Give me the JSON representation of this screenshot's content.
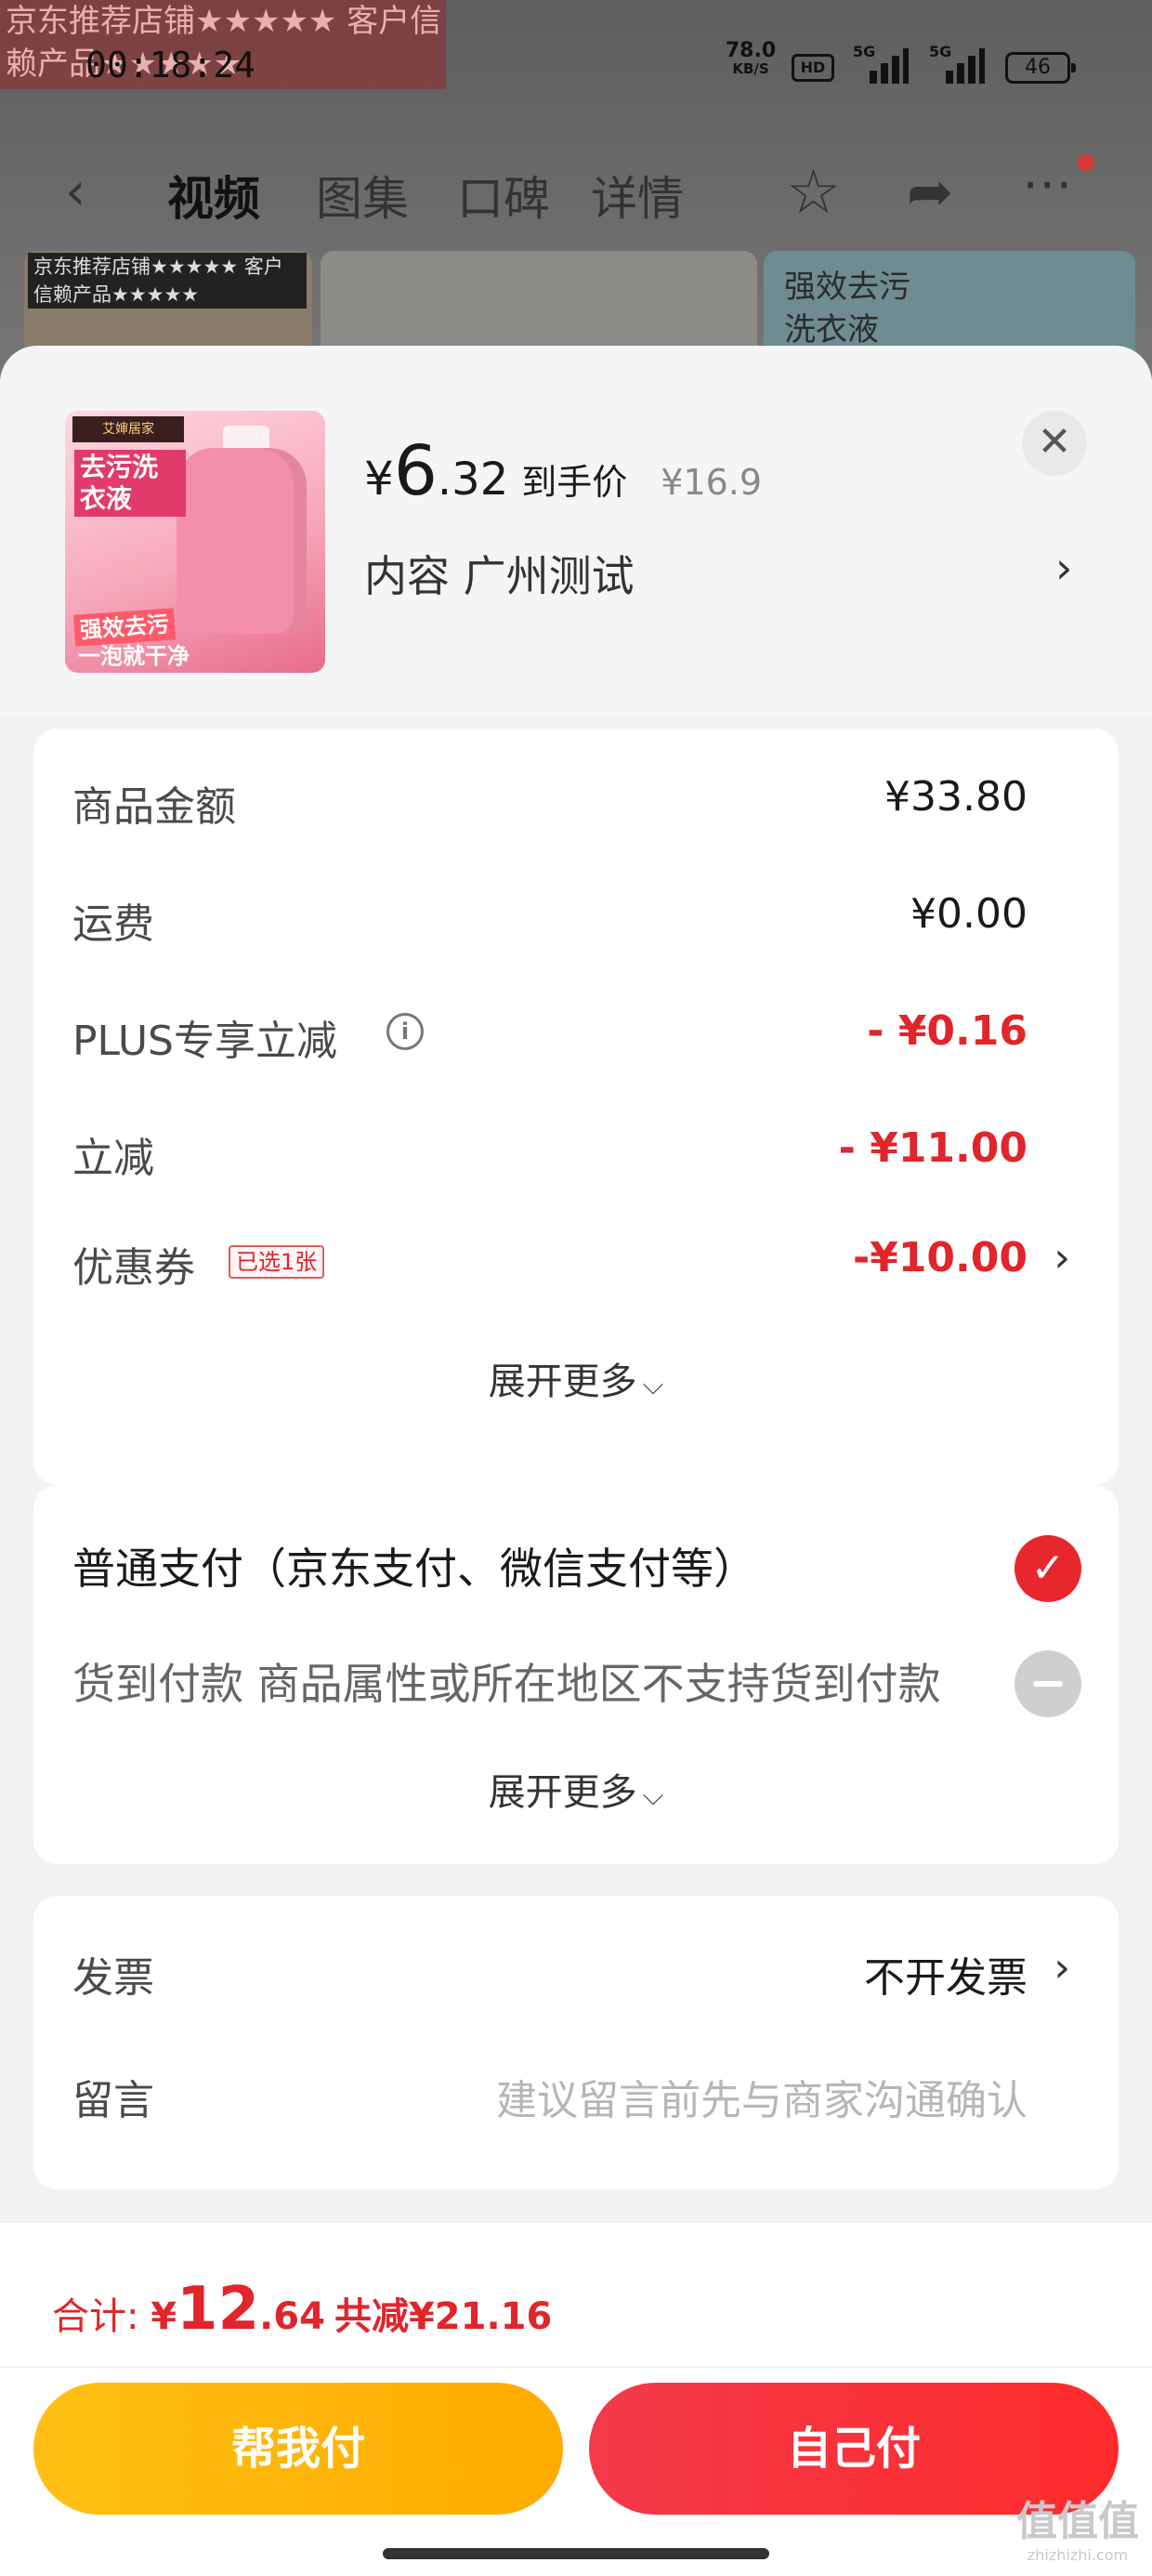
{
  "background": {
    "stamp": "京东推荐店铺★★★★★ 客户信赖产品★★★★★",
    "status_bar": {
      "time": "00:18:24",
      "net_speed": "78.0",
      "net_unit": "KB/S",
      "hd": "HD",
      "sig1": "5G",
      "sig2": "5G",
      "battery": "46"
    },
    "nav": {
      "tabs": [
        "视频",
        "图集",
        "口碑",
        "详情"
      ]
    },
    "thumb_tag": "京东推荐店铺★★★★★ 客户信赖产品★★★★★",
    "thumb_caption": "强效去污\n洗衣液"
  },
  "product": {
    "image_labels": {
      "top": "艾婶居家",
      "label1": "去污洗衣液",
      "label2": "强效去污",
      "label3": "一泡就干净"
    },
    "price_currency": "¥",
    "price_int": "6",
    "price_dec": ".32",
    "price_label": "到手价",
    "original_price": "¥16.9",
    "spec": "内容  广州测试"
  },
  "fees": {
    "goods_label": "商品金额",
    "goods_value": "¥33.80",
    "shipping_label": "运费",
    "shipping_value": "¥0.00",
    "plus_label": "PLUS专享立减",
    "plus_value": "- ¥0.16",
    "discount_label": "立减",
    "discount_value": "- ¥11.00",
    "coupon_label": "优惠券",
    "coupon_tag": "已选1张",
    "coupon_value": "-¥10.00",
    "expand_label": "展开更多"
  },
  "payment": {
    "normal_label": "普通支付（京东支付、微信支付等）",
    "cod_label": "货到付款 商品属性或所在地区不支持货到付款",
    "expand_label": "展开更多"
  },
  "extra": {
    "invoice_label": "发票",
    "invoice_value": "不开发票",
    "message_label": "留言",
    "message_placeholder": "建议留言前先与商家沟通确认"
  },
  "footer": {
    "total_label": "合计: ",
    "total_currency": "¥",
    "total_int": "12",
    "total_dec": ".64",
    "total_saving": "共减¥21.16",
    "help_pay": "帮我付",
    "self_pay": "自己付"
  },
  "watermark": {
    "big": "值值值",
    "small": "zhizhizhi.com"
  },
  "colors": {
    "accent_red": "#e0252b",
    "help_yellow": "#ffb000",
    "self_red": "#f5303e"
  },
  "icons": [
    "back-icon",
    "star-icon",
    "share-icon",
    "more-icon",
    "close-icon",
    "info-icon",
    "chevron-right-icon",
    "check-icon",
    "disabled-icon",
    "chevron-down-icon"
  ]
}
